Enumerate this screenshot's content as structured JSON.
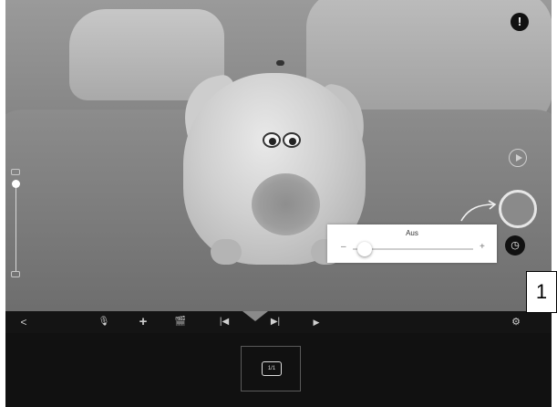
{
  "viewport": {
    "info_icon": "info-icon",
    "info_glyph": "!",
    "play_icon": "play-circle-icon",
    "shutter_icon": "shutter-button",
    "timer_icon": "timer-icon",
    "timer_glyph": "◷",
    "zoom_level": 0.0
  },
  "aus_panel": {
    "title": "Aus",
    "minus": "–",
    "plus": "+",
    "value_fraction": 0.05
  },
  "toolbar": {
    "back": "<",
    "mic": "🎙",
    "add": "+",
    "clapper": "🎬",
    "skip_back": "|◀",
    "skip_forward": "▶|",
    "play": "▶",
    "settings": "⚙"
  },
  "thumbnail": {
    "label": "1/1"
  },
  "callout": {
    "number": "1"
  },
  "colors": {
    "bar": "#141414",
    "panel": "#ffffff"
  }
}
